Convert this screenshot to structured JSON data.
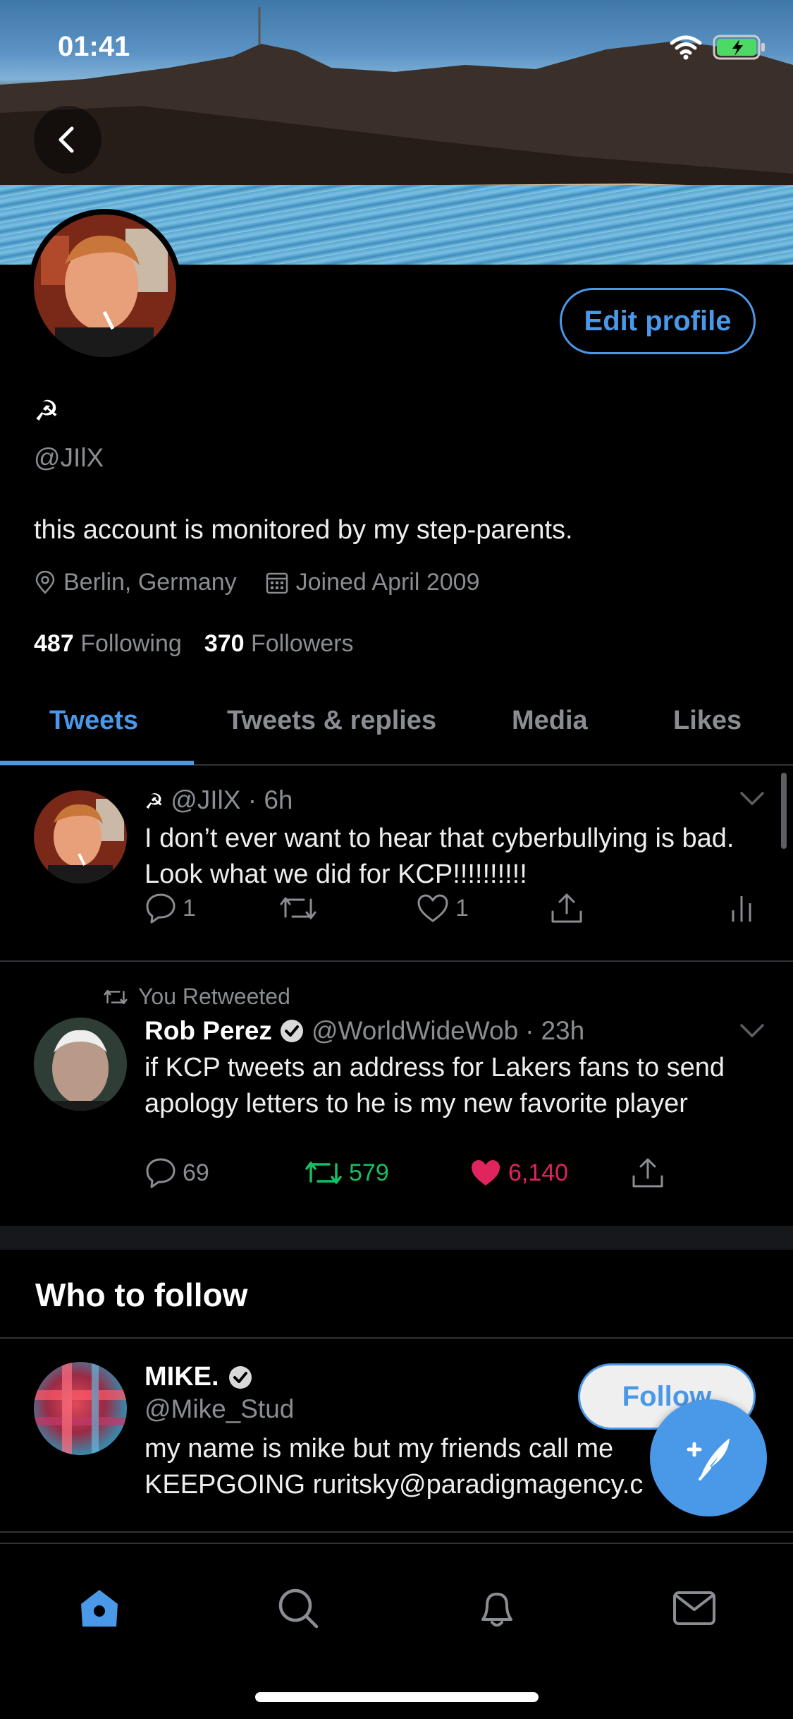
{
  "status_bar": {
    "time": "01:41"
  },
  "profile": {
    "display_name": "☭",
    "handle": "@JIlX",
    "bio": "this account is monitored by my step-parents.",
    "location": "Berlin, Germany",
    "joined": "Joined April 2009",
    "following_count": "487",
    "following_label": "Following",
    "followers_count": "370",
    "followers_label": "Followers",
    "edit_profile_label": "Edit profile"
  },
  "tabs": [
    {
      "label": "Tweets"
    },
    {
      "label": "Tweets & replies"
    },
    {
      "label": "Media"
    },
    {
      "label": "Likes"
    }
  ],
  "tweets": [
    {
      "name": "☭",
      "handle": "@JIlX",
      "time": "6h",
      "text": "I don’t ever want to hear that cyberbullying is bad. Look what we did for KCP!!!!!!!!!!",
      "replies": "1",
      "retweets": "",
      "likes": "1"
    },
    {
      "retweeted_label": "You Retweeted",
      "name": "Rob Perez",
      "handle": "@WorldWideWob",
      "time": "23h",
      "text": "if KCP tweets an address for Lakers fans to send apology letters to he is my new favorite player",
      "replies": "69",
      "retweets": "579",
      "likes": "6,140"
    }
  ],
  "who_to_follow": {
    "title": "Who to follow",
    "suggestion": {
      "name": "MIKE.",
      "handle": "@Mike_Stud",
      "bio_line1": "my name is mike but my friends call me",
      "bio_line2": "KEEPGOING ruritsky@paradigmagency.c",
      "follow_label": "Follow"
    }
  },
  "colors": {
    "accent": "#4a98e8",
    "retweet_green": "#17bf63",
    "like_red": "#e0245e",
    "muted": "#8a8d91"
  },
  "icons": [
    "back-arrow-icon",
    "wifi-icon",
    "battery-icon",
    "location-icon",
    "calendar-icon",
    "reply-icon",
    "retweet-icon",
    "like-icon",
    "share-icon",
    "analytics-icon",
    "chevron-down-icon",
    "verified-icon",
    "compose-icon",
    "home-icon",
    "search-icon",
    "notifications-icon",
    "messages-icon"
  ]
}
